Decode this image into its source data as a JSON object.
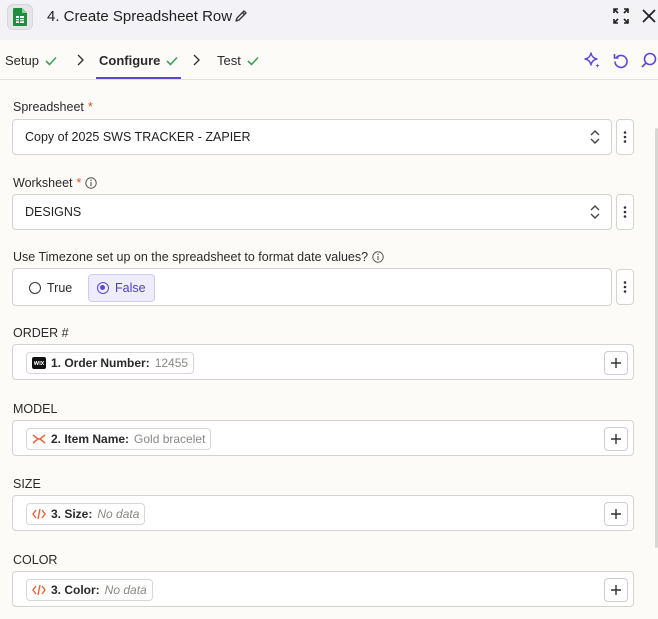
{
  "header": {
    "title": "4. Create Spreadsheet Row"
  },
  "tabs": [
    {
      "label": "Setup",
      "complete": true
    },
    {
      "label": "Configure",
      "complete": true,
      "active": true
    },
    {
      "label": "Test",
      "complete": true
    }
  ],
  "fields": {
    "spreadsheet": {
      "label": "Spreadsheet",
      "required": "*",
      "value": "Copy of 2025 SWS TRACKER - ZAPIER"
    },
    "worksheet": {
      "label": "Worksheet",
      "required": "*",
      "value": "DESIGNS"
    },
    "timezone": {
      "label": "Use Timezone set up on the spreadsheet to format date values?",
      "options": [
        "True",
        "False"
      ],
      "selected": "False"
    },
    "order": {
      "label": "ORDER #",
      "pill_key": "1. Order Number:",
      "pill_value": "12455",
      "source_icon": "wix-icon"
    },
    "model": {
      "label": "MODEL",
      "pill_key": "2. Item Name:",
      "pill_value": "Gold bracelet",
      "source_icon": "formatter-icon"
    },
    "size": {
      "label": "SIZE",
      "pill_key": "3. Size:",
      "pill_value": "No data",
      "source_icon": "code-icon"
    },
    "color": {
      "label": "COLOR",
      "pill_key": "3. Color:",
      "pill_value": "No data",
      "source_icon": "code-icon"
    }
  },
  "colors": {
    "accent": "#5b47d6",
    "check": "#3aa35a",
    "required": "#d9531e",
    "sheets_green": "#1e8e3e",
    "zapier_orange": "#e8643a"
  }
}
